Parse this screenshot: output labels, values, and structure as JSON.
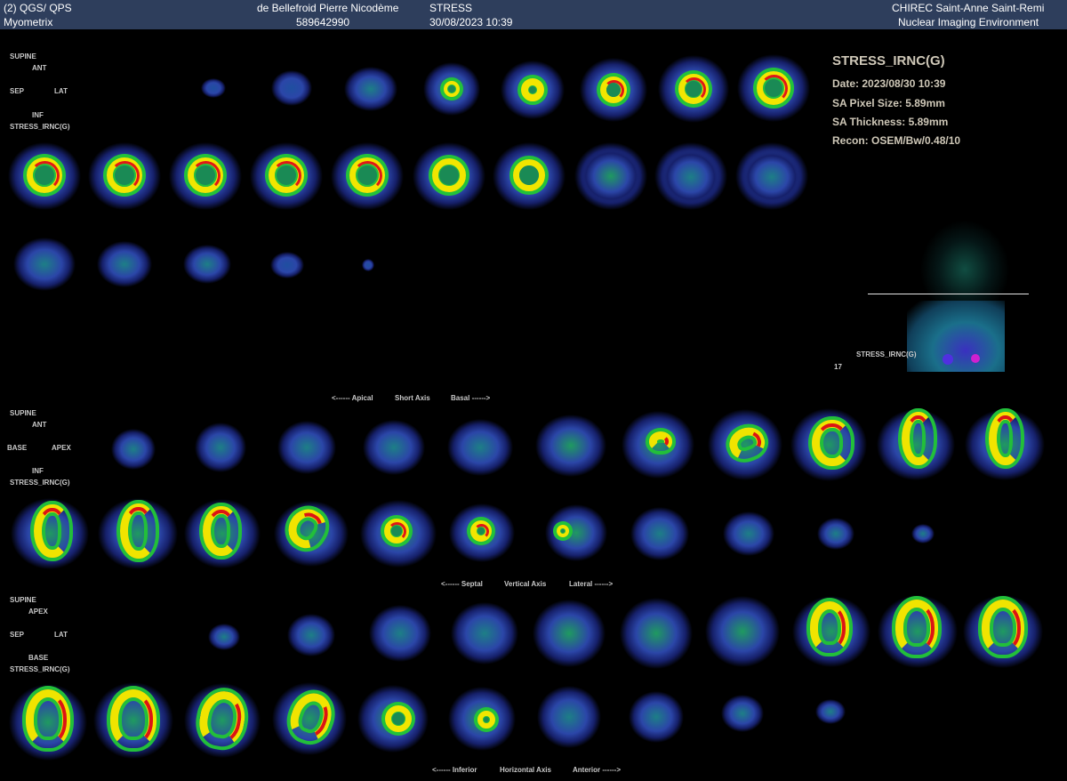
{
  "header": {
    "app_title": "(2) QGS/ QPS",
    "module": "Myometrix",
    "patient_name": "de Bellefroid Pierre Nicodème",
    "patient_id": "589642990",
    "study_type": "STRESS",
    "study_datetime": "30/08/2023 10:39",
    "institution": "CHIREC Saint-Anne Saint-Remi",
    "environment": "Nuclear Imaging Environment"
  },
  "info_panel": {
    "title": "STRESS_IRNC(G)",
    "date": "Date: 2023/08/30 10:39",
    "pixel_size": "SA Pixel Size: 5.89mm",
    "thickness": "SA Thickness: 5.89mm",
    "recon": "Recon: OSEM/Bw/0.48/10",
    "projection_label": "STRESS_IRNC(G)",
    "projection_number": "17"
  },
  "short_axis": {
    "orientation": {
      "top": "SUPINE",
      "up": "ANT",
      "left": "SEP",
      "right": "LAT",
      "down": "INF",
      "series": "STRESS_IRNC(G)"
    },
    "caption": {
      "left": "<------ Apical",
      "center": "Short Axis",
      "right": "Basal ------>"
    }
  },
  "vertical_axis": {
    "orientation": {
      "top": "SUPINE",
      "up": "ANT",
      "left": "BASE",
      "right": "APEX",
      "down": "INF",
      "series": "STRESS_IRNC(G)"
    },
    "caption": {
      "left": "<------ Septal",
      "center": "Vertical Axis",
      "right": "Lateral ------>"
    }
  },
  "horizontal_axis": {
    "orientation": {
      "top": "SUPINE",
      "up": "APEX",
      "left": "SEP",
      "right": "LAT",
      "down": "BASE",
      "series": "STRESS_IRNC(G)"
    },
    "caption": {
      "left": "<------ Inferior",
      "center": "Horizontal Axis",
      "right": "Anterior ------>"
    }
  },
  "colors": {
    "header_bg": "#2e3e5c",
    "background": "#000000",
    "label_text": "#c9c9c9",
    "info_text": "#cfc8b8",
    "colormap": [
      "#0a0a3c",
      "#2b3fa8",
      "#1d8a7a",
      "#1ec23a",
      "#f5f000",
      "#e01010"
    ]
  }
}
